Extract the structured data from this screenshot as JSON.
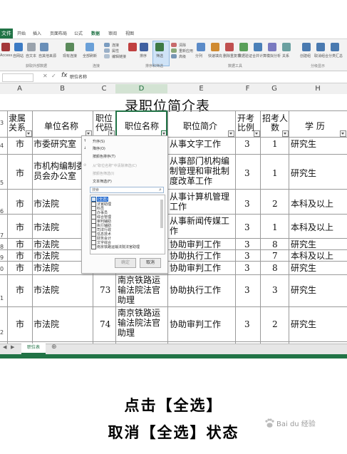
{
  "ribbon": {
    "file_tab": "文件",
    "tabs": [
      "开始",
      "插入",
      "页面布局",
      "公式",
      "数据",
      "审阅",
      "视图"
    ],
    "buttons": [
      "Access",
      "自网站",
      "自文本",
      "自其他来源",
      "现有连接",
      "全部刷新",
      "连接",
      "属性",
      "编辑链接",
      "排序",
      "筛选",
      "清除",
      "重新应用",
      "高级",
      "分列",
      "快速填充",
      "删除重复项",
      "数据验证",
      "合并计算",
      "模拟分析",
      "关系",
      "创建组",
      "取消组合",
      "分类汇总"
    ],
    "groups": [
      "获取外部数据",
      "连接",
      "排序和筛选",
      "数据工具",
      "分级显示"
    ]
  },
  "formula_bar": {
    "x_icon": "✕",
    "check_icon": "✓",
    "fx": "fx",
    "content": "职位名称"
  },
  "columns": [
    "A",
    "B",
    "C",
    "D",
    "E",
    "F",
    "G",
    "H"
  ],
  "sheet": {
    "title": "录职位简介表",
    "headers": {
      "a": "隶属关系",
      "b": "单位名称",
      "c": "职位代码",
      "d": "职位名称",
      "e": "职位简介",
      "f": "开考比例",
      "g": "招考人数",
      "h": "学 历"
    },
    "row_numbers": [
      "3",
      "4",
      "5",
      "6",
      "7",
      "8",
      "9",
      "0",
      "1",
      "2"
    ],
    "rows": [
      {
        "a": "市",
        "b": "市委研究室",
        "c": "",
        "d": "",
        "e": "从事文字工作",
        "f": "3",
        "g": "1",
        "h": "研究生"
      },
      {
        "a": "市",
        "b": "市机构编制委员会办公室",
        "c": "",
        "d": "",
        "e": "从事部门机构编制管理和审批制度改革工作",
        "f": "3",
        "g": "1",
        "h": "研究生"
      },
      {
        "a": "市",
        "b": "市法院",
        "c": "",
        "d": "",
        "e": "从事计算机管理工作",
        "f": "3",
        "g": "2",
        "h": "本科及以上"
      },
      {
        "a": "市",
        "b": "市法院",
        "c": "",
        "d": "",
        "e": "从事新闻传媒工作",
        "f": "3",
        "g": "1",
        "h": "本科及以上"
      },
      {
        "a": "市",
        "b": "市法院",
        "c": "",
        "d": "",
        "e": "协助审判工作",
        "f": "3",
        "g": "8",
        "h": "研究生"
      },
      {
        "a": "市",
        "b": "市法院",
        "c": "",
        "d": "",
        "e": "协助执行工作",
        "f": "3",
        "g": "7",
        "h": "本科及以上"
      },
      {
        "a": "市",
        "b": "市法院",
        "c": "",
        "d": "",
        "e": "协助审判工作",
        "f": "3",
        "g": "8",
        "h": "研究生"
      },
      {
        "a": "市",
        "b": "市法院",
        "c": "73",
        "d": "南京铁路运输法院法官助理",
        "e": "协助执行工作",
        "f": "3",
        "g": "3",
        "h": "研究生"
      },
      {
        "a": "市",
        "b": "市法院",
        "c": "74",
        "d": "南京铁路运输法院法官助理",
        "e": "协助审判工作",
        "f": "3",
        "g": "2",
        "h": "研究生"
      }
    ],
    "tab_name": "职位表",
    "add_sheet_icon": "⊕"
  },
  "filter_popup": {
    "menu": [
      "升序(S)",
      "降序(O)",
      "按颜色排序(T)",
      "从\"职位名称\"中清除筛选(C)",
      "按颜色筛选(I)",
      "文本筛选(F)"
    ],
    "search_placeholder": "搜索",
    "items": [
      "(全选)",
      "法官助理",
      "科员",
      "办事员",
      "综合管理",
      "审判辅助",
      "执行辅助",
      "司法行政",
      "信息技术",
      "财务会计",
      "文字综合",
      "南京铁路运输法院法官助理"
    ],
    "ok": "确定",
    "cancel": "取消"
  },
  "captions": {
    "line1": "点击【全选】",
    "line2": "取消【全选】状态"
  },
  "watermark": "Bai du 经验",
  "colors": {
    "excel_green": "#217346"
  }
}
